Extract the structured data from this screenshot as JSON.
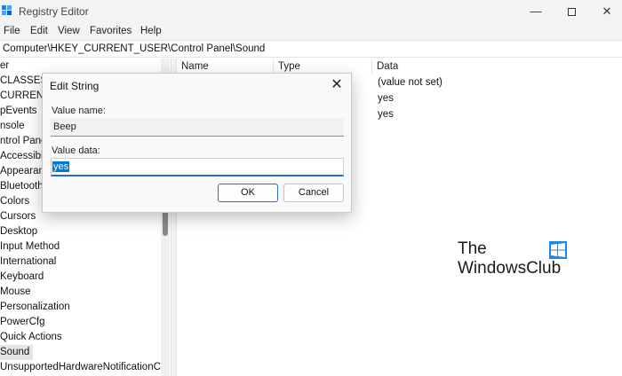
{
  "window": {
    "title": "Registry Editor",
    "minimize_glyph": "—",
    "close_glyph": "✕"
  },
  "menu": {
    "items": [
      "File",
      "Edit",
      "View",
      "Favorites",
      "Help"
    ]
  },
  "address": {
    "path": "Computer\\HKEY_CURRENT_USER\\Control Panel\\Sound"
  },
  "tree": {
    "items": [
      "er",
      "CLASSES_",
      "CURRENT",
      "pEvents",
      "nsole",
      "ntrol Panel",
      "Accessibility",
      "Appearance",
      "Bluetooth",
      "Colors",
      "Cursors",
      "Desktop",
      "Input Method",
      "International",
      "Keyboard",
      "Mouse",
      "Personalization",
      "PowerCfg",
      "Quick Actions",
      "Sound",
      "UnsupportedHardwareNotificationCa"
    ],
    "selected": "Sound"
  },
  "list": {
    "headers": {
      "name": "Name",
      "type": "Type",
      "data": "Data"
    },
    "data_values": [
      "(value not set)",
      "yes",
      "yes"
    ]
  },
  "dialog": {
    "title": "Edit String",
    "value_name_label": "Value name:",
    "value_name": "Beep",
    "value_data_label": "Value data:",
    "value_data": "yes",
    "ok_label": "OK",
    "cancel_label": "Cancel",
    "close_glyph": "✕"
  },
  "watermark": {
    "line1": "The",
    "line2": "WindowsClub",
    "logo_color": "#1e88e5"
  },
  "colors": {
    "accent": "#0078d7",
    "selection_bg": "#e5e5e5"
  }
}
